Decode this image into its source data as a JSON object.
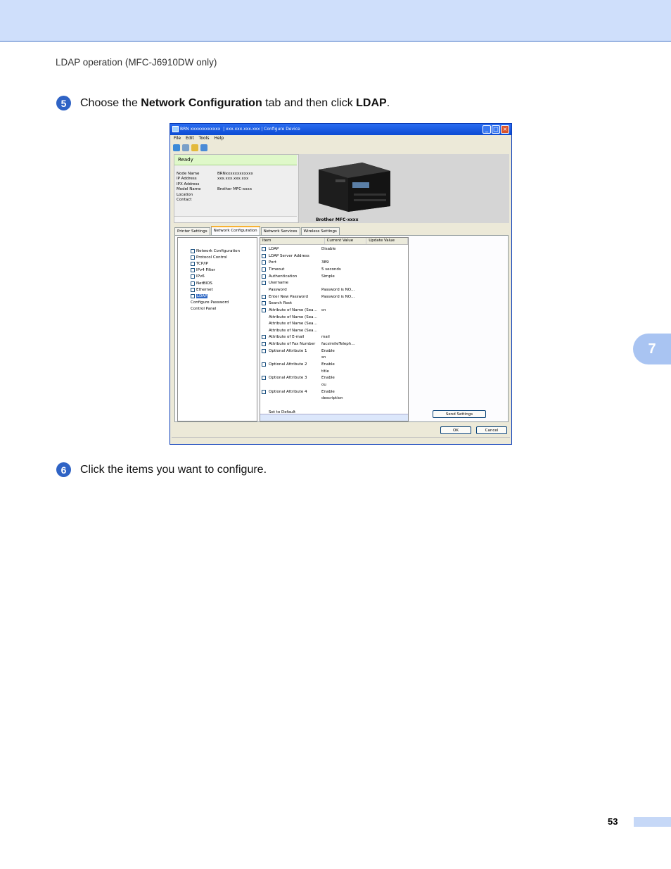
{
  "header": {
    "running_title": "LDAP operation (MFC-J6910DW only)"
  },
  "steps": [
    {
      "num": "5",
      "pre": "Choose the ",
      "bold1": "Network Configuration",
      "mid": " tab and then click ",
      "bold2": "LDAP",
      "post": "."
    },
    {
      "num": "6",
      "text": "Click the items you want to configure."
    }
  ],
  "chapter_tab": "7",
  "page_number": "53",
  "dialog": {
    "title": "BRN xxxxxxxxxxxx  | xxx.xxx.xxx.xxx | Configure Device",
    "menu": [
      "File",
      "Edit",
      "Tools",
      "Help"
    ],
    "status": "Ready",
    "props": [
      {
        "label": "Node Name",
        "value": "BRNxxxxxxxxxxxx"
      },
      {
        "label": "IP Address",
        "value": "xxx.xxx.xxx.xxx"
      },
      {
        "label": "IPX Address",
        "value": ""
      },
      {
        "label": "Model Name",
        "value": "Brother MFC-xxxx"
      },
      {
        "label": "Location",
        "value": ""
      },
      {
        "label": "Contact",
        "value": ""
      }
    ],
    "printer_name": "Brother MFC-xxxx",
    "tabs": [
      "Printer Settings",
      "Network Configuration",
      "Network Services",
      "Wireless Settings"
    ],
    "tree": [
      {
        "label": "Network Configuration",
        "check": true
      },
      {
        "label": "Protocol Control",
        "check": true
      },
      {
        "label": "TCP/IP",
        "check": true
      },
      {
        "label": "IPv4 Filter",
        "check": true
      },
      {
        "label": "IPv6",
        "check": true
      },
      {
        "label": "NetBIOS",
        "check": true
      },
      {
        "label": "Ethernet",
        "check": true
      },
      {
        "label": "LDAP",
        "check": true,
        "selected": true
      },
      {
        "label": "Configure Password",
        "check": false
      },
      {
        "label": "Control Panel",
        "check": false
      }
    ],
    "columns": [
      "Item",
      "Current Value",
      "Update Value"
    ],
    "rows": [
      {
        "item": "LDAP",
        "value": "Disable",
        "check": true
      },
      {
        "item": "LDAP Server Address",
        "value": "",
        "check": true
      },
      {
        "item": "Port",
        "value": "389",
        "check": true
      },
      {
        "item": "Timeout",
        "value": "5 seconds",
        "check": true
      },
      {
        "item": "Authentication",
        "value": "Simple",
        "check": true
      },
      {
        "item": "Username",
        "value": "",
        "check": true
      },
      {
        "item": "Password",
        "value": "Password is NO…",
        "check": false
      },
      {
        "item": "Enter New Password",
        "value": "Password is NO…",
        "check": true
      },
      {
        "item": "Search Root",
        "value": "",
        "check": true
      },
      {
        "item": "Attribute of Name (Sea…",
        "value": "cn",
        "check": true
      },
      {
        "item": "Attribute of Name (Sea…",
        "value": "",
        "check": false
      },
      {
        "item": "Attribute of Name (Sea…",
        "value": "",
        "check": false
      },
      {
        "item": "Attribute of Name (Sea…",
        "value": "",
        "check": false
      },
      {
        "item": "Attribute of E-mail",
        "value": "mail",
        "check": true
      },
      {
        "item": "Attribute of Fax Number",
        "value": "facsimileTeleph…",
        "check": true
      },
      {
        "item": "Optional Attribute 1",
        "value": "Enable",
        "check": true
      },
      {
        "item": "",
        "value": "sn",
        "check": false
      },
      {
        "item": "Optional Attribute 2",
        "value": "Enable",
        "check": true
      },
      {
        "item": "",
        "value": "title",
        "check": false
      },
      {
        "item": "Optional Attribute 3",
        "value": "Enable",
        "check": true
      },
      {
        "item": "",
        "value": "ou",
        "check": false
      },
      {
        "item": "Optional Attribute 4",
        "value": "Enable",
        "check": true
      },
      {
        "item": "",
        "value": "description",
        "check": false
      },
      {
        "item": "",
        "value": "",
        "check": false
      },
      {
        "item": "Set to Default",
        "value": "",
        "check": false
      }
    ],
    "send_settings": "Send Settings",
    "ok": "OK",
    "cancel": "Cancel"
  }
}
